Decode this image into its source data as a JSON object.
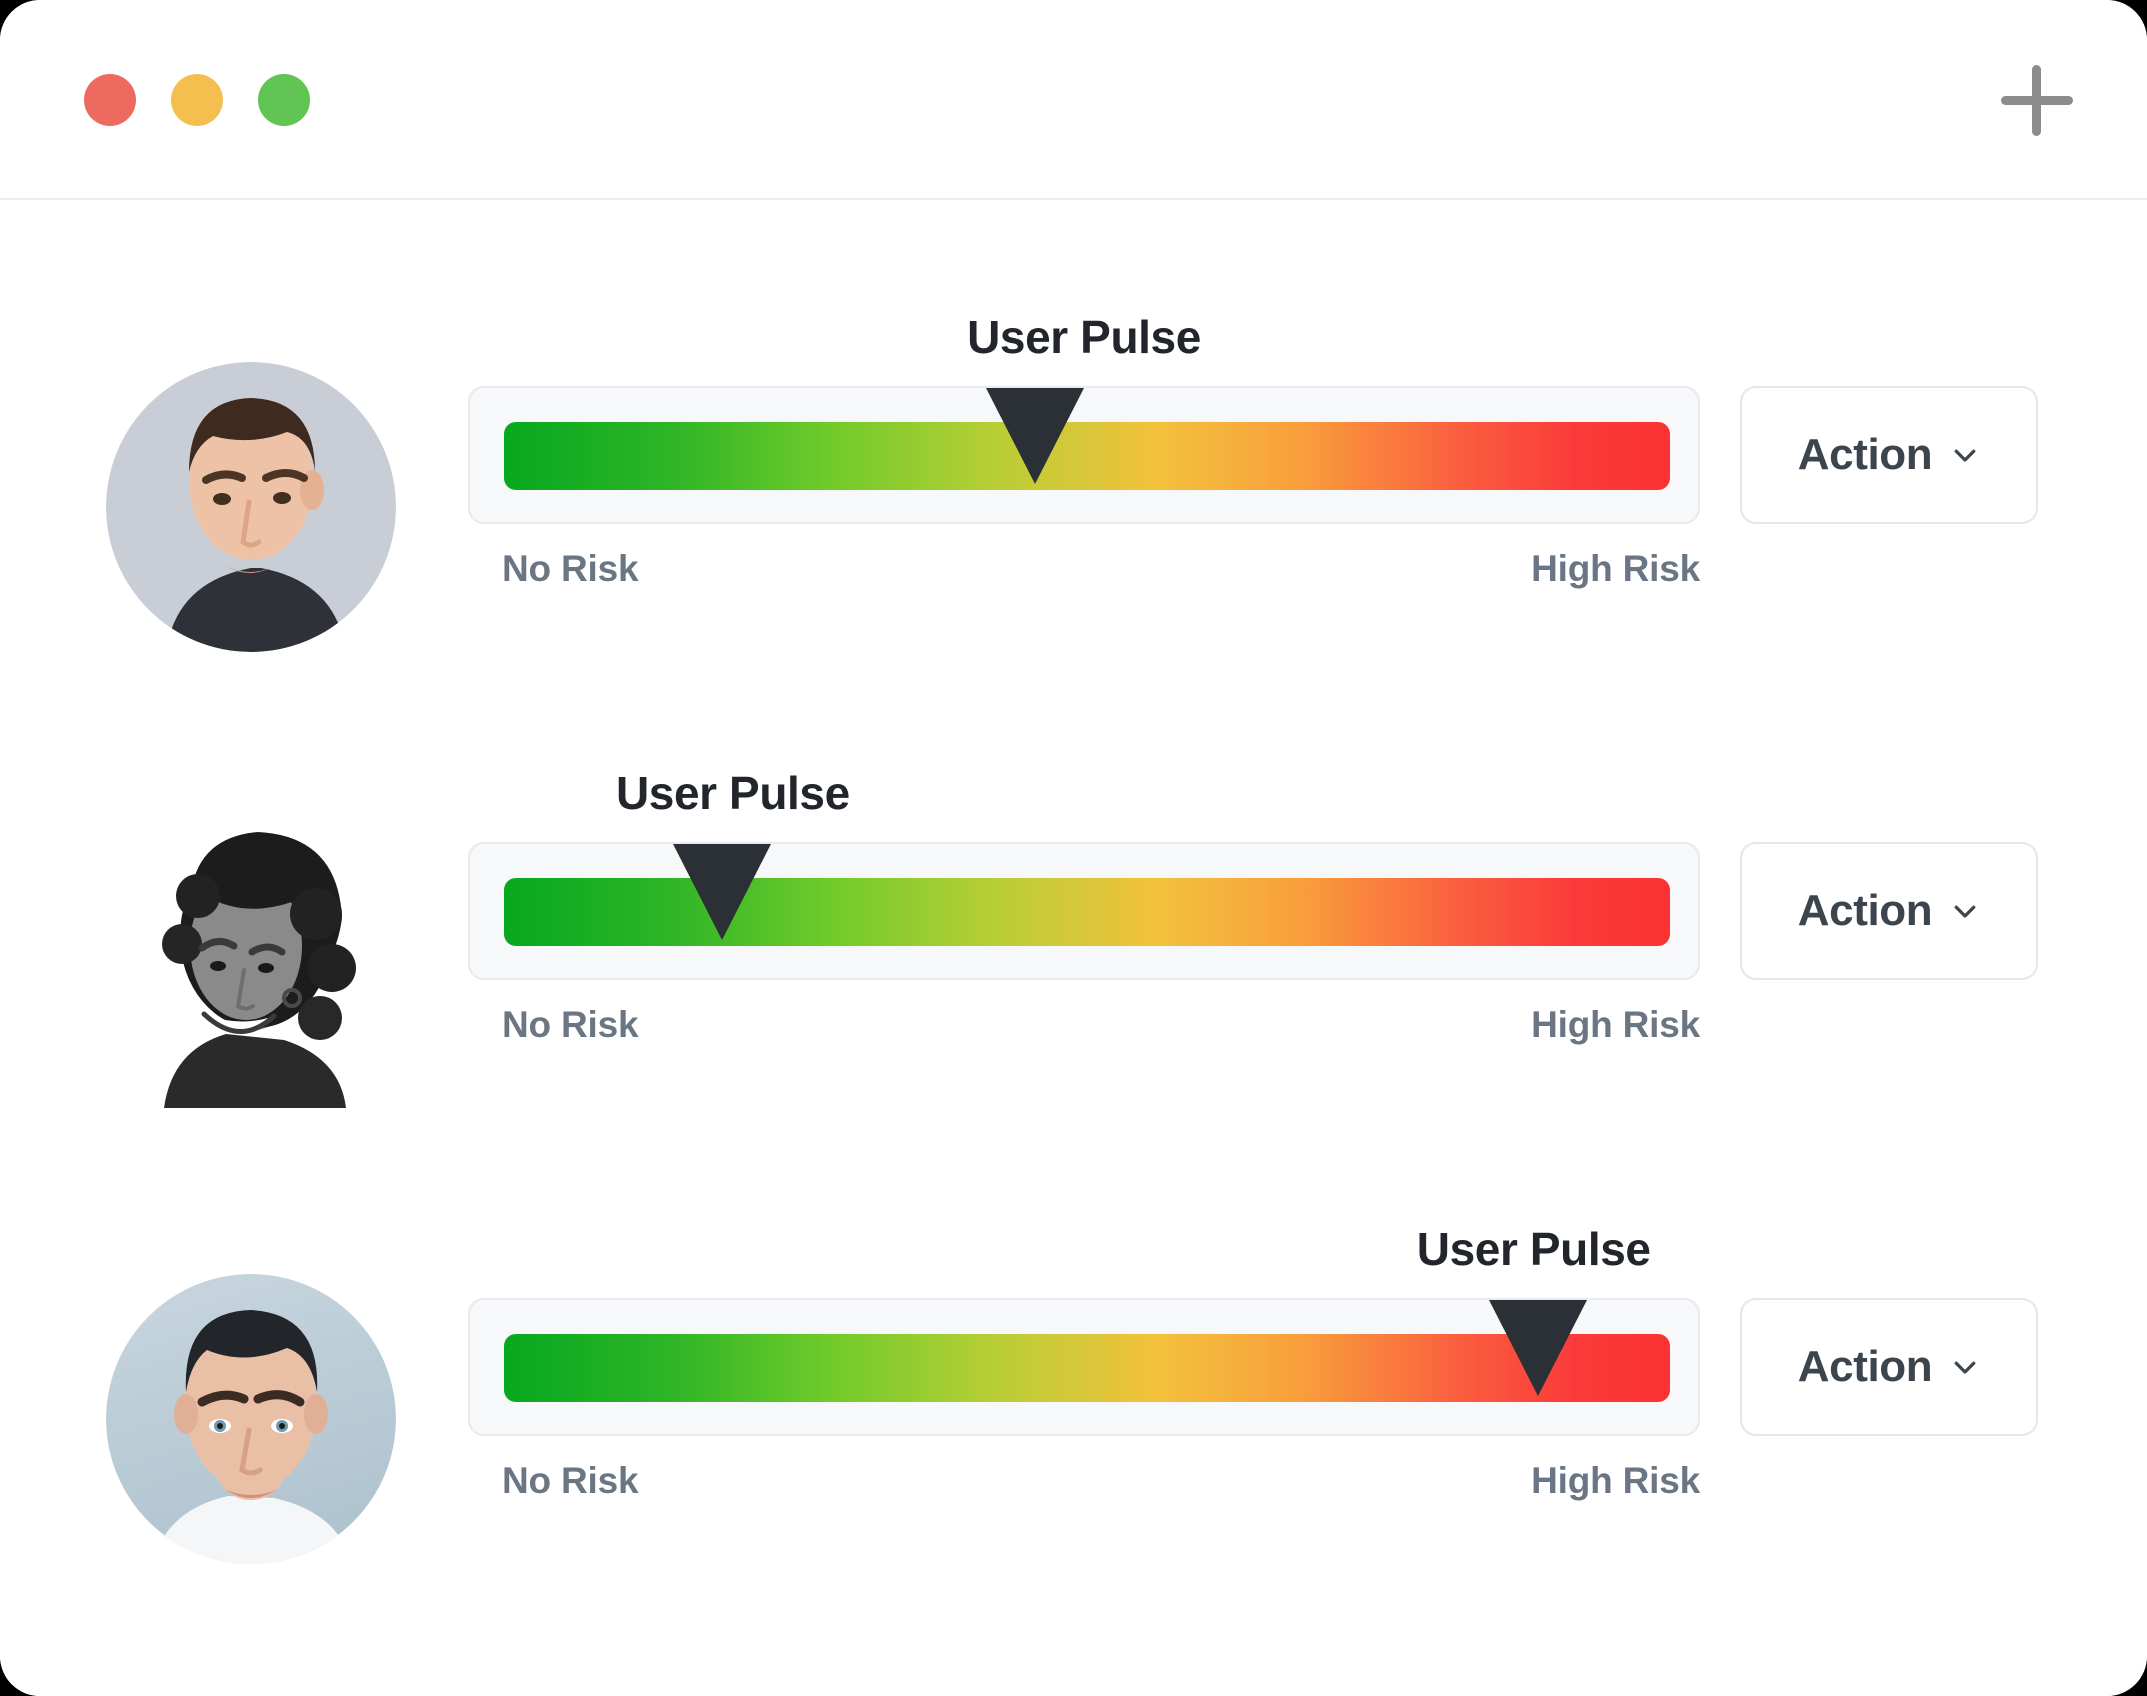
{
  "window": {
    "traffic_lights": [
      {
        "name": "close-button",
        "color": "#EC6A5E"
      },
      {
        "name": "minimize-button",
        "color": "#F4BF4F"
      },
      {
        "name": "maximize-button",
        "color": "#61C554"
      }
    ],
    "add_button": {
      "icon": "plus-icon",
      "color": "#8C8C8C"
    }
  },
  "rows": [
    {
      "avatar": {
        "icon": "avatar-photo",
        "description": "young man with short brown hair",
        "background": "#C9CED6",
        "hair": "#3E2A1E",
        "skin": "#EEC2A6",
        "shirt": "#2E3238",
        "grayscale": false
      },
      "title": "User Pulse",
      "title_center_pct": 50,
      "marker_pct": 46,
      "labels": {
        "left": "No Risk",
        "right": "High Risk"
      },
      "action": {
        "label": "Action",
        "icon": "chevron-down-icon"
      }
    },
    {
      "avatar": {
        "icon": "avatar-photo",
        "description": "smiling woman with curly hair",
        "background": "#FFFFFF",
        "hair": "#1C1C1C",
        "skin": "#8A8A8A",
        "shirt": "#2A2A2A",
        "grayscale": true
      },
      "title": "User Pulse",
      "title_center_pct": 21.5,
      "marker_pct": 20.5,
      "labels": {
        "left": "No Risk",
        "right": "High Risk"
      },
      "action": {
        "label": "Action",
        "icon": "chevron-down-icon"
      }
    },
    {
      "avatar": {
        "icon": "avatar-photo",
        "description": "young man with dark hair and white shirt",
        "background": "#BCCCD6",
        "hair": "#22262B",
        "skin": "#E9BFA6",
        "shirt": "#F4F6F8",
        "grayscale": false
      },
      "title": "User Pulse",
      "title_center_pct": 86.5,
      "marker_pct": 87,
      "labels": {
        "left": "No Risk",
        "right": "High Risk"
      },
      "action": {
        "label": "Action",
        "icon": "chevron-down-icon"
      }
    }
  ],
  "colors": {
    "gauge_start": "#07A81E",
    "gauge_mid": "#F3C13C",
    "gauge_end": "#FA3232",
    "marker": "#2B3036",
    "title_text": "#22262C",
    "label_text": "#6B7684",
    "action_text": "#3C444E",
    "card_bg": "#F7F8FA",
    "card_border": "#E8EAEE"
  }
}
